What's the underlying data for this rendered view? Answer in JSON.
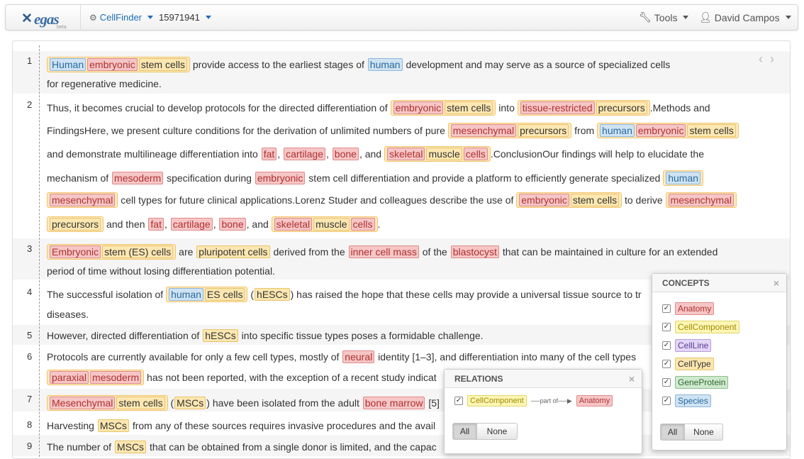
{
  "nav": {
    "logo_text": "egas",
    "logo_sub": "beta",
    "project": "CellFinder",
    "doc_id": "15971941",
    "tools": "Tools",
    "user": "David Campos"
  },
  "sentences": [
    {
      "num": "1",
      "lines": [
        [
          [
            "g",
            [
              [
                "s",
                "Human"
              ],
              [
                "a",
                "embryonic"
              ],
              [
                "c",
                "stem cells"
              ]
            ]
          ],
          [
            "x",
            " provide access to the earliest stages of "
          ],
          [
            "s",
            "human"
          ],
          [
            "x",
            " development and may serve as a source of specialized cells"
          ]
        ],
        [
          [
            "x",
            "for regenerative medicine."
          ]
        ]
      ]
    },
    {
      "num": "2",
      "lines": [
        [
          [
            "x",
            "Thus, it becomes crucial to develop protocols for the directed differentiation of "
          ],
          [
            "g",
            [
              [
                "a",
                "embryonic"
              ],
              [
                "c",
                "stem cells"
              ]
            ]
          ],
          [
            "x",
            " into "
          ],
          [
            "g",
            [
              [
                "a",
                "tissue-restricted"
              ],
              [
                "c",
                "precursors"
              ]
            ]
          ],
          [
            "x",
            ".Methods and"
          ]
        ],
        [
          [
            "x",
            "FindingsHere, we present culture conditions for the derivation of unlimited numbers of pure "
          ],
          [
            "g",
            [
              [
                "a",
                "mesenchymal"
              ],
              [
                "c",
                "precursors"
              ]
            ]
          ],
          [
            "x",
            " from "
          ],
          [
            "g",
            [
              [
                "s",
                "human"
              ],
              [
                "a",
                "embryonic"
              ],
              [
                "c",
                "stem cells"
              ]
            ]
          ]
        ],
        [
          [
            "x",
            "and demonstrate multilineage differentiation into "
          ],
          [
            "a",
            "fat"
          ],
          [
            "x",
            ", "
          ],
          [
            "a",
            "cartilage"
          ],
          [
            "x",
            ", "
          ],
          [
            "a",
            "bone"
          ],
          [
            "x",
            ", and "
          ],
          [
            "g",
            [
              [
                "a",
                "skeletal"
              ],
              [
                "c",
                "muscle"
              ],
              [
                "a",
                "cells"
              ]
            ]
          ],
          [
            "x",
            ".ConclusionOur findings will help to elucidate the"
          ]
        ],
        [
          [
            "x",
            "mechanism of "
          ],
          [
            "a",
            "mesoderm"
          ],
          [
            "x",
            " specification during "
          ],
          [
            "a",
            "embryonic"
          ],
          [
            "x",
            " stem cell differentiation and provide a platform to efficiently generate specialized "
          ],
          [
            "g",
            [
              [
                "s",
                "human"
              ]
            ]
          ]
        ],
        [
          [
            "g",
            [
              [
                "a",
                "mesenchymal"
              ]
            ]
          ],
          [
            "x",
            " cell types for future clinical applications.Lorenz Studer and colleagues describe the use of "
          ],
          [
            "g",
            [
              [
                "a",
                "embryonic"
              ],
              [
                "c",
                "stem cells"
              ]
            ]
          ],
          [
            "x",
            " to derive "
          ],
          [
            "g",
            [
              [
                "a",
                "mesenchymal"
              ]
            ]
          ]
        ],
        [
          [
            "g",
            [
              [
                "c",
                "precursors"
              ]
            ]
          ],
          [
            "x",
            " and then "
          ],
          [
            "a",
            "fat"
          ],
          [
            "x",
            ", "
          ],
          [
            "a",
            "cartilage"
          ],
          [
            "x",
            ", "
          ],
          [
            "a",
            "bone"
          ],
          [
            "x",
            ", and "
          ],
          [
            "g",
            [
              [
                "a",
                "skeletal"
              ],
              [
                "c",
                "muscle"
              ],
              [
                "a",
                "cells"
              ]
            ]
          ],
          [
            "x",
            "."
          ]
        ]
      ]
    },
    {
      "num": "3",
      "lines": [
        [
          [
            "g",
            [
              [
                "a",
                "Embryonic"
              ],
              [
                "c",
                "stem (ES) cells"
              ]
            ]
          ],
          [
            "x",
            " are "
          ],
          [
            "c",
            "pluripotent cells"
          ],
          [
            "x",
            " derived from the "
          ],
          [
            "a",
            "inner cell mass"
          ],
          [
            "x",
            " of the "
          ],
          [
            "a",
            "blastocyst"
          ],
          [
            "x",
            " that can be maintained in culture for an extended"
          ]
        ],
        [
          [
            "x",
            "period of time without losing differentiation potential."
          ]
        ]
      ]
    },
    {
      "num": "4",
      "lines": [
        [
          [
            "x",
            "The successful isolation of "
          ],
          [
            "g",
            [
              [
                "s",
                "human"
              ],
              [
                "c",
                "ES cells"
              ]
            ]
          ],
          [
            "x",
            " ("
          ],
          [
            "c",
            "hESCs"
          ],
          [
            "x",
            ") has raised the hope that these cells may provide a universal tissue source to tr"
          ]
        ],
        [
          [
            "x",
            "diseases."
          ]
        ]
      ]
    },
    {
      "num": "5",
      "lines": [
        [
          [
            "x",
            "However, directed differentiation of "
          ],
          [
            "c",
            "hESCs"
          ],
          [
            "x",
            " into specific tissue types poses a formidable challenge."
          ]
        ]
      ]
    },
    {
      "num": "6",
      "lines": [
        [
          [
            "x",
            "Protocols are currently available for only a few cell types, mostly of "
          ],
          [
            "a",
            "neural"
          ],
          [
            "x",
            " identity [1–3], and differentiation into many of the cell types"
          ]
        ],
        [
          [
            "g",
            [
              [
                "a",
                "paraxial"
              ],
              [
                "a",
                "mesoderm"
              ]
            ]
          ],
          [
            "x",
            " has not been reported, with the exception of a recent study indicat"
          ]
        ]
      ]
    },
    {
      "num": "7",
      "lines": [
        [
          [
            "g",
            [
              [
                "a",
                "Mesenchymal"
              ],
              [
                "c",
                "stem cells"
              ]
            ]
          ],
          [
            "x",
            " ("
          ],
          [
            "c",
            "MSCs"
          ],
          [
            "x",
            ") have been isolated from the adult "
          ],
          [
            "a",
            "bone marrow"
          ],
          [
            "x",
            " [5]"
          ]
        ]
      ]
    },
    {
      "num": "8",
      "lines": [
        [
          [
            "x",
            "Harvesting "
          ],
          [
            "c",
            "MSCs"
          ],
          [
            "x",
            " from any of these sources requires invasive procedures and the avail"
          ]
        ]
      ]
    },
    {
      "num": "9",
      "lines": [
        [
          [
            "x",
            "The number of "
          ],
          [
            "c",
            "MSCs"
          ],
          [
            "x",
            " that can be obtained from a single donor is limited, and the capac"
          ]
        ]
      ]
    }
  ],
  "concepts": {
    "title": "CONCEPTS",
    "items": [
      {
        "label": "Anatomy",
        "bg": "#f6c6c6",
        "border": "#e08b8b",
        "color": "#b03030"
      },
      {
        "label": "CellComponent",
        "bg": "#fdf6b5",
        "border": "#e3d66a",
        "color": "#a08a00"
      },
      {
        "label": "CellLine",
        "bg": "#e3d5f5",
        "border": "#b59ddb",
        "color": "#5b3b95"
      },
      {
        "label": "CellType",
        "bg": "#fde7b0",
        "border": "#e8c36b",
        "color": "#333333"
      },
      {
        "label": "GeneProtein",
        "bg": "#cfe9cf",
        "border": "#8cc08c",
        "color": "#2f6a2f"
      },
      {
        "label": "Species",
        "bg": "#cfe3f3",
        "border": "#8fb6da",
        "color": "#2a6aa0"
      }
    ],
    "all": "All",
    "none": "None"
  },
  "relations": {
    "title": "RELATIONS",
    "from": "CellComponent",
    "rel": "part of",
    "to": "Anatomy",
    "all": "All",
    "none": "None"
  }
}
